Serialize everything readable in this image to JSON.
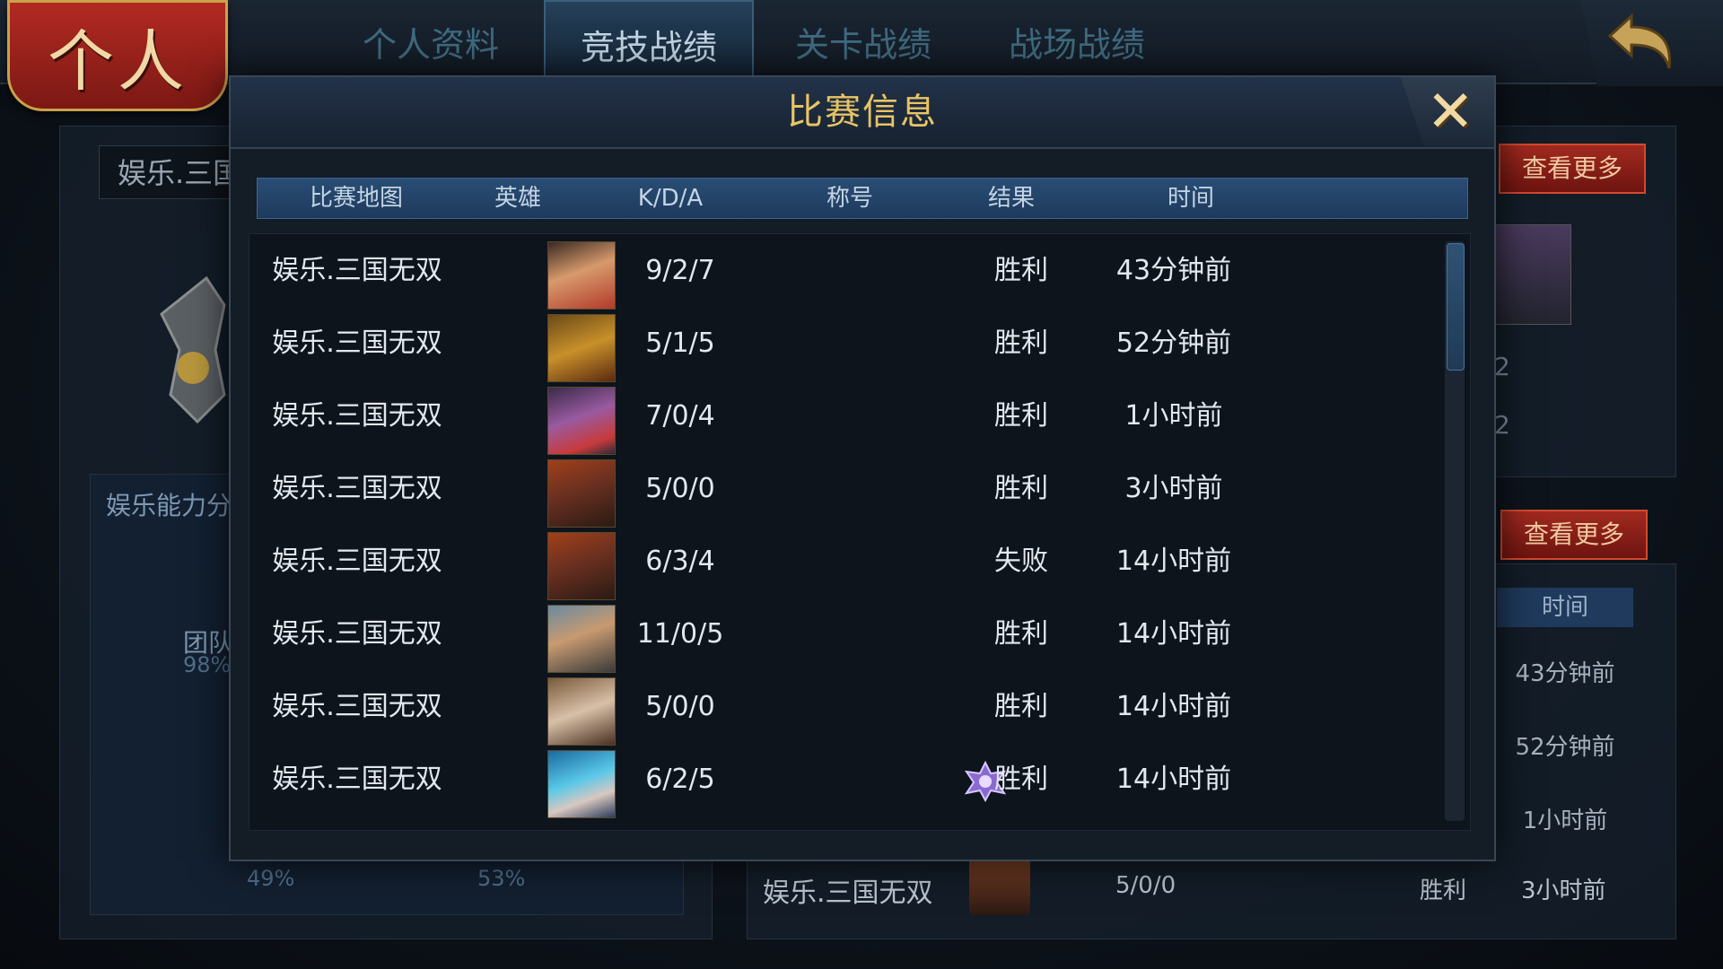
{
  "header": {
    "title": "个人",
    "tabs": [
      {
        "label": "个人资料",
        "active": false
      },
      {
        "label": "竞技战绩",
        "active": true
      },
      {
        "label": "关卡战绩",
        "active": false
      },
      {
        "label": "战场战绩",
        "active": false
      }
    ]
  },
  "background": {
    "search_value": "娱乐.三国",
    "ability_label": "娱乐能力分",
    "stat1_label": "团队",
    "stat1_value": "98%",
    "stat2_value": "49%",
    "stat3_value": "53%",
    "more_button_1": "查看更多",
    "more_button_2": "查看更多",
    "right_numbers": [
      "2",
      "2"
    ],
    "time_header": "时间",
    "times": [
      "43分钟前",
      "52分钟前",
      "1小时前"
    ],
    "bottom_row": {
      "map": "娱乐.三国无双",
      "kda": "5/0/0",
      "result": "胜利",
      "time": "3小时前"
    }
  },
  "dialog": {
    "title": "比赛信息",
    "close_glyph": "✕",
    "columns": [
      "比赛地图",
      "英雄",
      "K/D/A",
      "称号",
      "结果",
      "时间"
    ],
    "rows": [
      {
        "map": "娱乐.三国无双",
        "hero": "hero-portrait-1",
        "kda": "9/2/7",
        "title": "",
        "result": "胜利",
        "time": "43分钟前"
      },
      {
        "map": "娱乐.三国无双",
        "hero": "hero-portrait-2",
        "kda": "5/1/5",
        "title": "",
        "result": "胜利",
        "time": "52分钟前"
      },
      {
        "map": "娱乐.三国无双",
        "hero": "hero-portrait-3",
        "kda": "7/0/4",
        "title": "",
        "result": "胜利",
        "time": "1小时前"
      },
      {
        "map": "娱乐.三国无双",
        "hero": "hero-portrait-4",
        "kda": "5/0/0",
        "title": "",
        "result": "胜利",
        "time": "3小时前"
      },
      {
        "map": "娱乐.三国无双",
        "hero": "hero-portrait-4",
        "kda": "6/3/4",
        "title": "",
        "result": "失败",
        "time": "14小时前"
      },
      {
        "map": "娱乐.三国无双",
        "hero": "hero-portrait-5",
        "kda": "11/0/5",
        "title": "",
        "result": "胜利",
        "time": "14小时前"
      },
      {
        "map": "娱乐.三国无双",
        "hero": "hero-portrait-6",
        "kda": "5/0/0",
        "title": "",
        "result": "胜利",
        "time": "14小时前"
      },
      {
        "map": "娱乐.三国无双",
        "hero": "hero-portrait-7",
        "kda": "6/2/5",
        "title": "badge-icon",
        "result": "胜利",
        "time": "14小时前"
      }
    ]
  },
  "colors": {
    "accent_gold": "#e9c464",
    "header_blue": "#1d3a5c",
    "more_button_red": "#a22a20"
  }
}
